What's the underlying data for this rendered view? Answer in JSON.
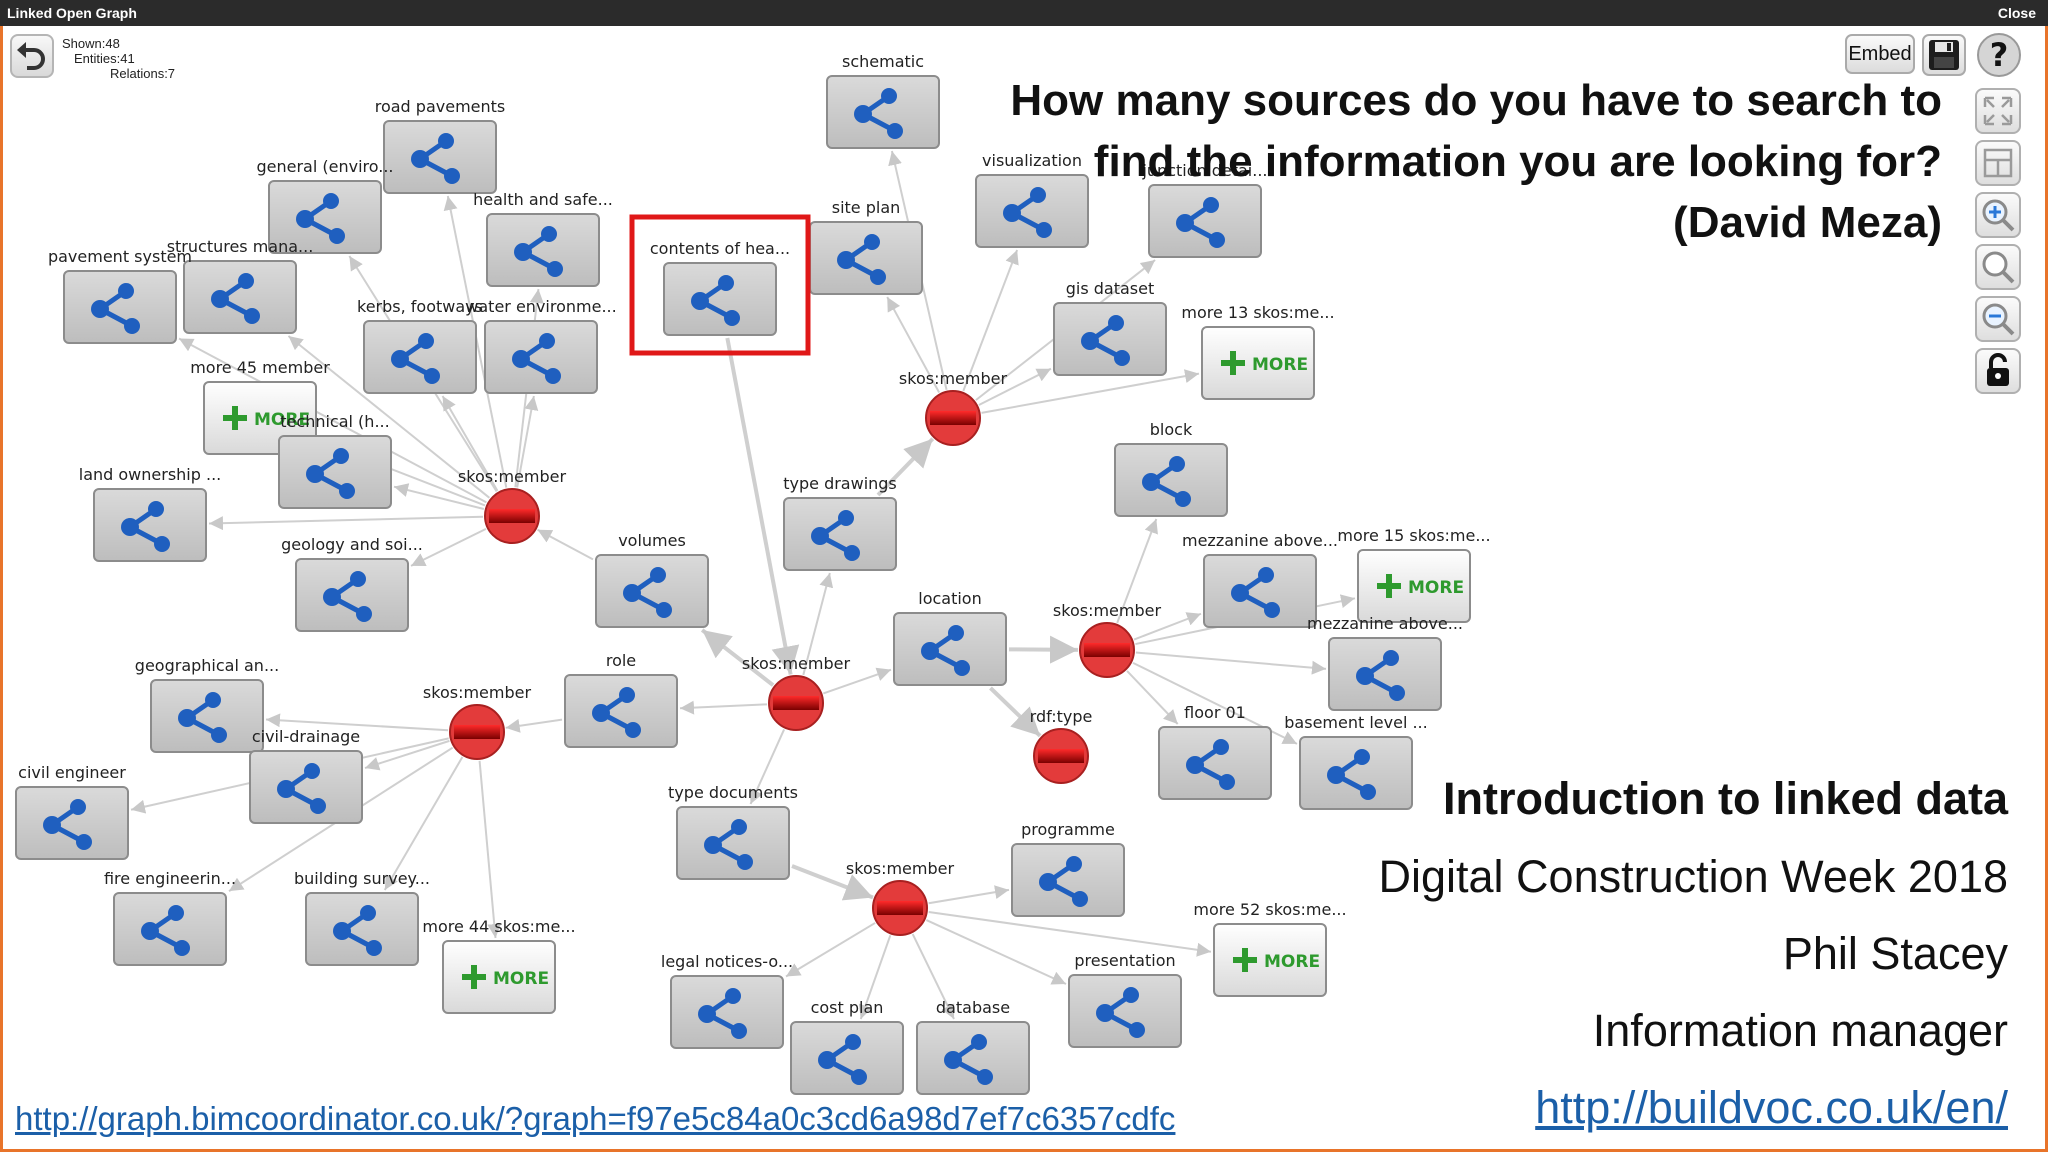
{
  "window": {
    "title": "Linked Open Graph",
    "close_label": "Close"
  },
  "stats": {
    "shown": "Shown:48",
    "entities": "Entities:41",
    "relations": "Relations:7"
  },
  "toolbar": {
    "embed_label": "Embed",
    "save_icon": "floppy-disk-icon",
    "help_icon": "question-icon",
    "tools": [
      "fullscreen-icon",
      "fit-window-icon",
      "zoom-in-icon",
      "zoom-reset-icon",
      "zoom-out-icon",
      "lock-icon"
    ]
  },
  "colors": {
    "accent_border": "#e8742a",
    "hub": "#e33b3b",
    "node_bg": "#cfcfcf",
    "node_icon": "#1f5fbf",
    "more_plus": "#2e9a2e",
    "link": "#1b5fa8"
  },
  "slide": {
    "question_lines": [
      "How many sources do you have to search to",
      "find the information you are looking for?",
      "(David Meza)"
    ],
    "talk_title": "Introduction to linked data",
    "event": "Digital Construction Week 2018",
    "speaker": "Phil Stacey",
    "role": "Information manager",
    "speaker_link": "http://buildvoc.co.uk/en/",
    "graph_link": "http://graph.bimcoordinator.co.uk/?graph=f97e5c84a0c3cd6a98d7ef7c6357cdfc"
  },
  "graph": {
    "highlighted": "contents of hea...",
    "more_badge": "MORE",
    "hubs": [
      {
        "id": "h1",
        "label": "skos:member"
      },
      {
        "id": "h2",
        "label": "skos:member"
      },
      {
        "id": "h3",
        "label": "skos:member"
      },
      {
        "id": "h4",
        "label": "skos:member"
      },
      {
        "id": "h5",
        "label": "skos:member"
      },
      {
        "id": "h6",
        "label": "skos:member"
      },
      {
        "id": "h7",
        "label": "rdf:type"
      }
    ],
    "nodes": [
      {
        "id": "n1",
        "label": "road pavements"
      },
      {
        "id": "n2",
        "label": "general (enviro..."
      },
      {
        "id": "n3",
        "label": "health and safe..."
      },
      {
        "id": "n4",
        "label": "structures mana..."
      },
      {
        "id": "n5",
        "label": "pavement system"
      },
      {
        "id": "n6",
        "label": "kerbs, footways"
      },
      {
        "id": "n7",
        "label": "water environme..."
      },
      {
        "id": "n8",
        "label": "more 45 member",
        "more": true
      },
      {
        "id": "n9",
        "label": "technical (h..."
      },
      {
        "id": "n10",
        "label": "land ownership ..."
      },
      {
        "id": "n11",
        "label": "geology and soi..."
      },
      {
        "id": "n12",
        "label": "volumes"
      },
      {
        "id": "n13",
        "label": "contents of hea..."
      },
      {
        "id": "n14",
        "label": "schematic"
      },
      {
        "id": "n15",
        "label": "site plan"
      },
      {
        "id": "n16",
        "label": "visualization"
      },
      {
        "id": "n17",
        "label": "junction detai..."
      },
      {
        "id": "n18",
        "label": "gis dataset"
      },
      {
        "id": "n19",
        "label": "more 13 skos:me...",
        "more": true
      },
      {
        "id": "n20",
        "label": "type drawings"
      },
      {
        "id": "n21",
        "label": "block"
      },
      {
        "id": "n22",
        "label": "mezzanine above..."
      },
      {
        "id": "n23",
        "label": "more 15 skos:me...",
        "more": true
      },
      {
        "id": "n24",
        "label": "location"
      },
      {
        "id": "n25",
        "label": "mezzanine above..."
      },
      {
        "id": "n26",
        "label": "floor 01"
      },
      {
        "id": "n27",
        "label": "basement level ..."
      },
      {
        "id": "n28",
        "label": "role"
      },
      {
        "id": "n29",
        "label": "geographical an..."
      },
      {
        "id": "n30",
        "label": "civil-drainage"
      },
      {
        "id": "n31",
        "label": "civil engineer"
      },
      {
        "id": "n32",
        "label": "fire engineerin..."
      },
      {
        "id": "n33",
        "label": "building survey..."
      },
      {
        "id": "n34",
        "label": "more 44 skos:me...",
        "more": true
      },
      {
        "id": "n35",
        "label": "type documents"
      },
      {
        "id": "n36",
        "label": "programme"
      },
      {
        "id": "n37",
        "label": "more 52 skos:me...",
        "more": true
      },
      {
        "id": "n38",
        "label": "legal notices-o..."
      },
      {
        "id": "n39",
        "label": "cost plan"
      },
      {
        "id": "n40",
        "label": "database"
      },
      {
        "id": "n41",
        "label": "presentation"
      }
    ],
    "edges": [
      [
        "h1",
        "n1"
      ],
      [
        "h1",
        "n2"
      ],
      [
        "h1",
        "n3"
      ],
      [
        "h1",
        "n4"
      ],
      [
        "h1",
        "n5"
      ],
      [
        "h1",
        "n6"
      ],
      [
        "h1",
        "n7"
      ],
      [
        "h1",
        "n8"
      ],
      [
        "h1",
        "n9"
      ],
      [
        "h1",
        "n10"
      ],
      [
        "h1",
        "n11"
      ],
      [
        "n12",
        "h1"
      ],
      [
        "n13",
        "h3"
      ],
      [
        "n20",
        "h2"
      ],
      [
        "h2",
        "n14"
      ],
      [
        "h2",
        "n15"
      ],
      [
        "h2",
        "n16"
      ],
      [
        "h2",
        "n17"
      ],
      [
        "h2",
        "n18"
      ],
      [
        "h2",
        "n19"
      ],
      [
        "h3",
        "n20"
      ],
      [
        "h3",
        "n24"
      ],
      [
        "h3",
        "n12"
      ],
      [
        "h3",
        "n28"
      ],
      [
        "h3",
        "n35"
      ],
      [
        "n24",
        "h4"
      ],
      [
        "n24",
        "h7"
      ],
      [
        "h4",
        "n21"
      ],
      [
        "h4",
        "n22"
      ],
      [
        "h4",
        "n23"
      ],
      [
        "h4",
        "n25"
      ],
      [
        "h4",
        "n26"
      ],
      [
        "h4",
        "n27"
      ],
      [
        "n28",
        "h5"
      ],
      [
        "h5",
        "n29"
      ],
      [
        "h5",
        "n30"
      ],
      [
        "h5",
        "n31"
      ],
      [
        "h5",
        "n32"
      ],
      [
        "h5",
        "n33"
      ],
      [
        "h5",
        "n34"
      ],
      [
        "n35",
        "h6"
      ],
      [
        "h6",
        "n36"
      ],
      [
        "h6",
        "n37"
      ],
      [
        "h6",
        "n38"
      ],
      [
        "h6",
        "n39"
      ],
      [
        "h6",
        "n40"
      ],
      [
        "h6",
        "n41"
      ]
    ]
  }
}
